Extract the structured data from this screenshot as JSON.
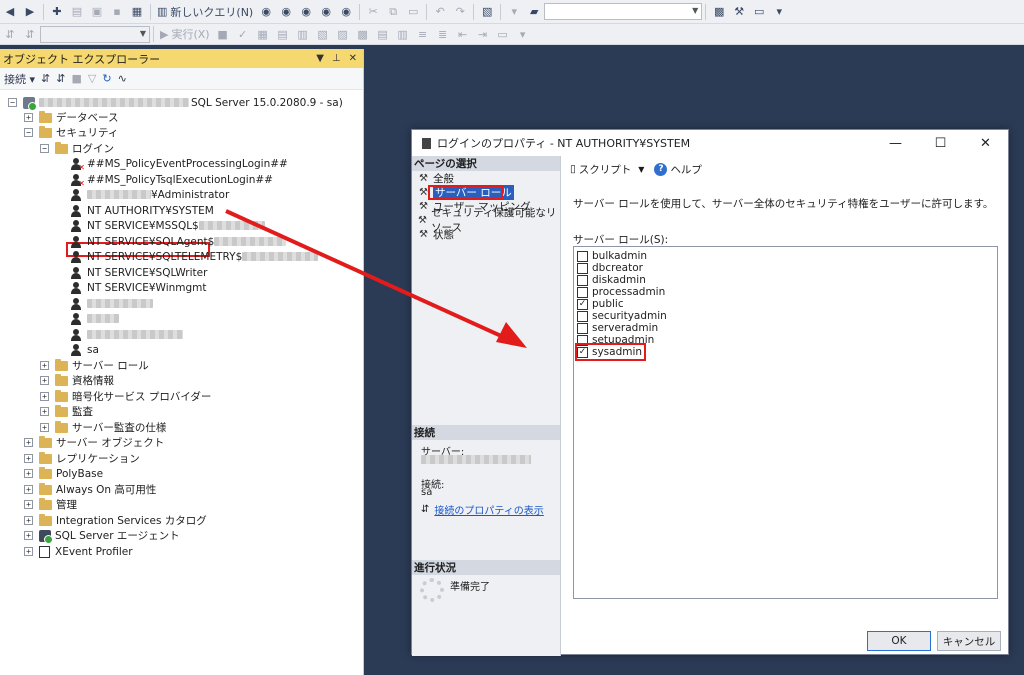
{
  "toolbar": {
    "new_query_label": "新しいクエリ(N)",
    "execute_label": "実行(X)"
  },
  "object_explorer": {
    "title": "オブジェクト エクスプローラー",
    "connect_label": "接続",
    "server_label": "SQL Server 15.0.2080.9 - sa)",
    "nodes": {
      "databases": "データベース",
      "security": "セキュリティ",
      "logins": "ログイン",
      "login1": "##MS_PolicyEventProcessingLogin##",
      "login2": "##MS_PolicyTsqlExecutionLogin##",
      "login3": "¥Administrator",
      "login4": "NT AUTHORITY¥SYSTEM",
      "login5": "NT SERVICE¥MSSQL$",
      "login6": "NT SERVICE¥SQLAgent$",
      "login7": "NT SERVICE¥SQLTELEMETRY$",
      "login8": "NT SERVICE¥SQLWriter",
      "login9": "NT SERVICE¥Winmgmt",
      "login_sa": "sa",
      "server_roles": "サーバー ロール",
      "credentials": "資格情報",
      "crypto": "暗号化サービス プロバイダー",
      "audits": "監査",
      "audit_specs": "サーバー監査の仕様",
      "server_objects": "サーバー オブジェクト",
      "replication": "レプリケーション",
      "polybase": "PolyBase",
      "always_on": "Always On 高可用性",
      "management": "管理",
      "integration": "Integration Services カタログ",
      "agent": "SQL Server エージェント",
      "xevent": "XEvent Profiler"
    }
  },
  "dialog": {
    "title": "ログインのプロパティ - NT AUTHORITY¥SYSTEM",
    "select_page_header": "ページの選択",
    "pages": [
      "全般",
      "サーバー ロール",
      "ユーザー マッピング",
      "セキュリティ保護可能なリソース",
      "状態"
    ],
    "script_label": "スクリプト",
    "help_label": "ヘルプ",
    "description": "サーバー ロールを使用して、サーバー全体のセキュリティ特権をユーザーに許可します。",
    "roles_label": "サーバー ロール(S):",
    "roles": [
      {
        "name": "bulkadmin",
        "checked": false
      },
      {
        "name": "dbcreator",
        "checked": false
      },
      {
        "name": "diskadmin",
        "checked": false
      },
      {
        "name": "processadmin",
        "checked": false
      },
      {
        "name": "public",
        "checked": true
      },
      {
        "name": "securityadmin",
        "checked": false
      },
      {
        "name": "serveradmin",
        "checked": false
      },
      {
        "name": "setupadmin",
        "checked": false
      },
      {
        "name": "sysadmin",
        "checked": true
      }
    ],
    "connection_header": "接続",
    "server_label": "サーバー:",
    "connection_label": "接続:",
    "connection_value": "sa",
    "view_conn_props": "接続のプロパティの表示",
    "progress_header": "進行状況",
    "progress_status": "準備完了",
    "ok_label": "OK",
    "cancel_label": "キャンセル"
  },
  "colors": {
    "highlight": "#e21b1b",
    "selection": "#2a5fbf"
  }
}
